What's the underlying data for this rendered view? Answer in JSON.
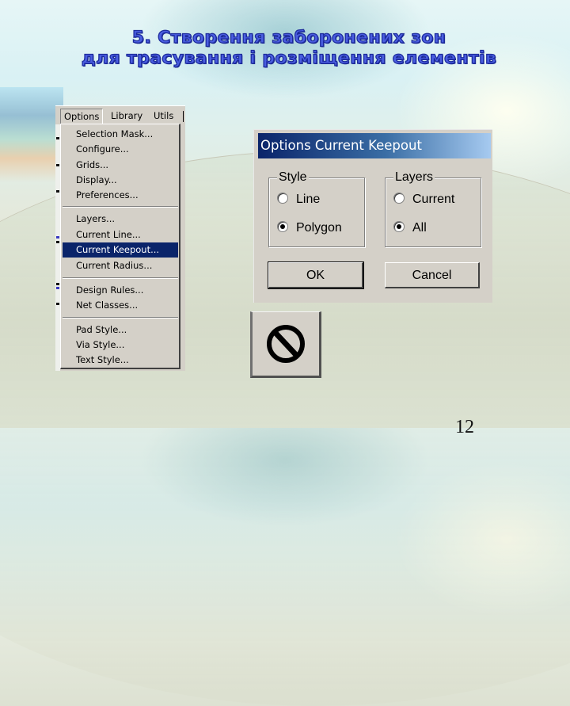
{
  "slide": {
    "title_line1": "5. Створення заборонених зон",
    "title_line2": "для трасування і розміщення елементів",
    "page_number": "12",
    "title_color": "#4a5ee0"
  },
  "menu": {
    "menubar": [
      "Options",
      "Library",
      "Utils"
    ],
    "active_menu": "Options",
    "groups": [
      [
        "Selection Mask...",
        "Configure...",
        "Grids...",
        "Display...",
        "Preferences..."
      ],
      [
        "Layers...",
        "Current Line...",
        "Current Keepout...",
        "Current Radius..."
      ],
      [
        "Design Rules...",
        "Net Classes..."
      ],
      [
        "Pad Style...",
        "Via Style...",
        "Text Style..."
      ]
    ],
    "highlighted_item": "Current Keepout...",
    "highlight_color": "#0a246a"
  },
  "dialog": {
    "title": "Options Current Keepout",
    "style_group": {
      "label": "Style",
      "options": [
        {
          "label": "Line",
          "selected": false
        },
        {
          "label": "Polygon",
          "selected": true
        }
      ]
    },
    "layers_group": {
      "label": "Layers",
      "options": [
        {
          "label": "Current",
          "selected": false
        },
        {
          "label": "All",
          "selected": true
        }
      ]
    },
    "ok_label": "OK",
    "cancel_label": "Cancel"
  },
  "toolbar_button": {
    "icon": "prohibited-icon",
    "meaning": "Keepout tool"
  }
}
